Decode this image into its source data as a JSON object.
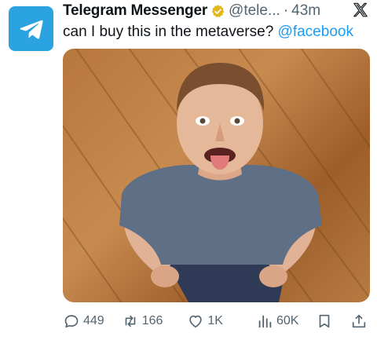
{
  "tweet": {
    "author_name": "Telegram Messenger",
    "handle": "@tele...",
    "separator": "·",
    "time": "43m",
    "text_main": "can I buy this in the metaverse? ",
    "text_mention": "@facebook"
  },
  "metrics": {
    "replies": "449",
    "retweets": "166",
    "likes": "1K",
    "views": "60K"
  },
  "colors": {
    "telegram_blue": "#2aa3e0",
    "link_blue": "#1d9bf0",
    "secondary_text": "#536471",
    "verified_gold": "#e2b719"
  }
}
